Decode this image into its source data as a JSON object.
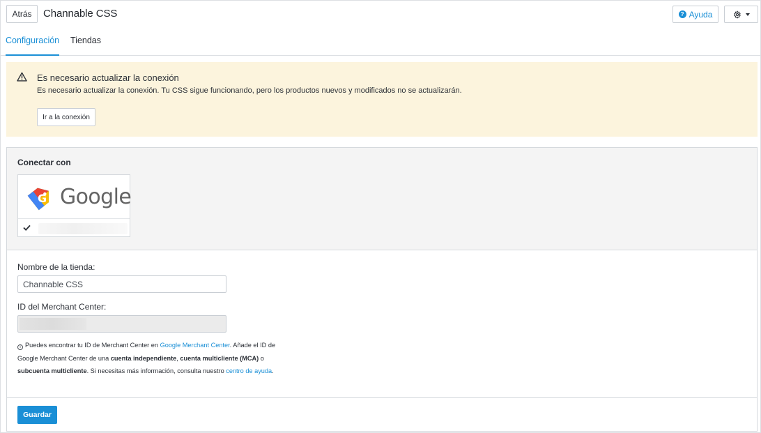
{
  "header": {
    "back_label": "Atrás",
    "title": "Channable CSS",
    "help_label": "Ayuda",
    "help_icon": "question-circle-icon",
    "settings_icon": "gear-icon"
  },
  "tabs": [
    {
      "label": "Configuración",
      "active": true
    },
    {
      "label": "Tiendas",
      "active": false
    }
  ],
  "warning": {
    "icon": "warning-triangle-icon",
    "title": "Es necesario actualizar la conexión",
    "text": "Es necesario actualizar la conexión. Tu CSS sigue funcionando, pero los productos nuevos y modificados no se actualizarán.",
    "button_label": "Ir a la conexión",
    "background": "#fcf4dd"
  },
  "connect": {
    "label": "Conectar con",
    "provider": "Google",
    "check_icon": "checkmark-icon"
  },
  "form": {
    "store_name_label": "Nombre de la tienda:",
    "store_name_value": "Channable CSS",
    "merchant_label": "ID del Merchant Center:",
    "help": {
      "t1": "Puedes encontrar tu ID de Merchant Center en ",
      "link1": "Google Merchant Center",
      "t2": ". Añade el ID de Google Merchant Center de una ",
      "b1": "cuenta independiente",
      "t3": ", ",
      "b2": "cuenta multicliente (MCA)",
      "t4": " o ",
      "b3": "subcuenta multicliente",
      "t5": ". Si necesitas más información, consulta nuestro ",
      "link2": "centro de ayuda",
      "t6": "."
    }
  },
  "save_label": "Guardar",
  "colors": {
    "accent": "#1a8fd6",
    "warning_bg": "#fcf4dd",
    "panel_bg": "#f4f4f4"
  }
}
